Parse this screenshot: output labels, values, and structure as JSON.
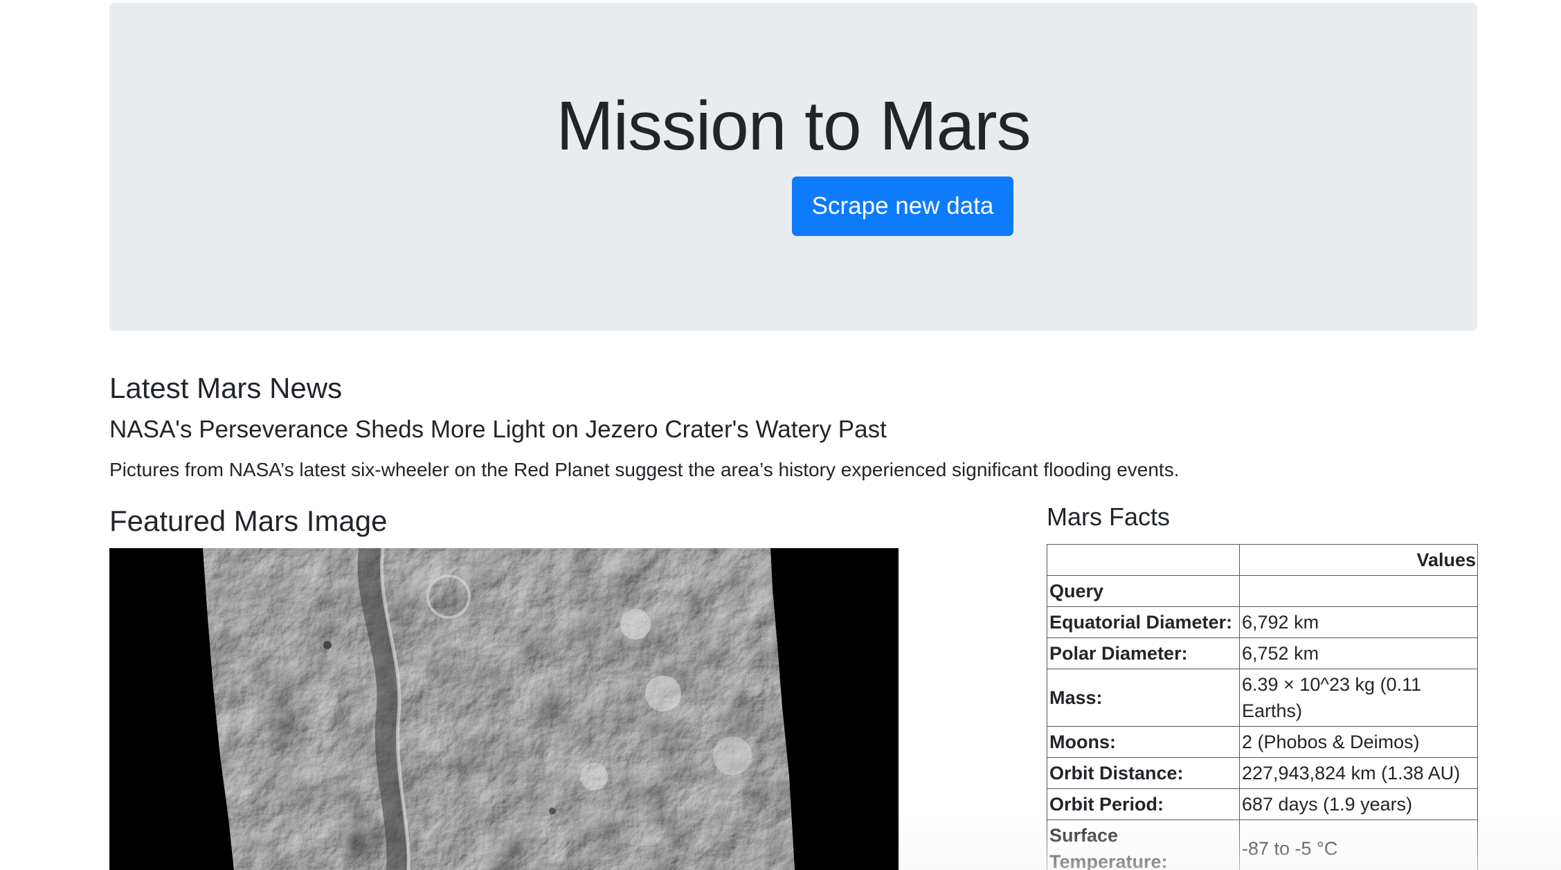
{
  "jumbotron": {
    "title": "Mission to Mars",
    "button_label": "Scrape new data"
  },
  "news": {
    "heading": "Latest Mars News",
    "title": "NASA's Perseverance Sheds More Light on Jezero Crater's Watery Past",
    "teaser": "Pictures from NASA’s latest six-wheeler on the Red Planet suggest the area’s history experienced significant flooding events."
  },
  "featured_image": {
    "heading": "Featured Mars Image"
  },
  "facts": {
    "heading": "Mars Facts",
    "header_values": "Values",
    "header_index": "Query",
    "rows": [
      {
        "label": "Equatorial Diameter:",
        "value": "6,792 km"
      },
      {
        "label": "Polar Diameter:",
        "value": "6,752 km"
      },
      {
        "label": "Mass:",
        "value": "6.39 × 10^23 kg (0.11 Earths)"
      },
      {
        "label": "Moons:",
        "value": "2 (Phobos & Deimos)"
      },
      {
        "label": "Orbit Distance:",
        "value": "227,943,824 km (1.38 AU)"
      },
      {
        "label": "Orbit Period:",
        "value": "687 days (1.9 years)"
      },
      {
        "label": "Surface Temperature:",
        "value": "-87 to -5 °C"
      }
    ]
  },
  "colors": {
    "jumbotron_bg": "#e9ecef",
    "button_bg": "#0d7bfc",
    "text": "#212529"
  }
}
